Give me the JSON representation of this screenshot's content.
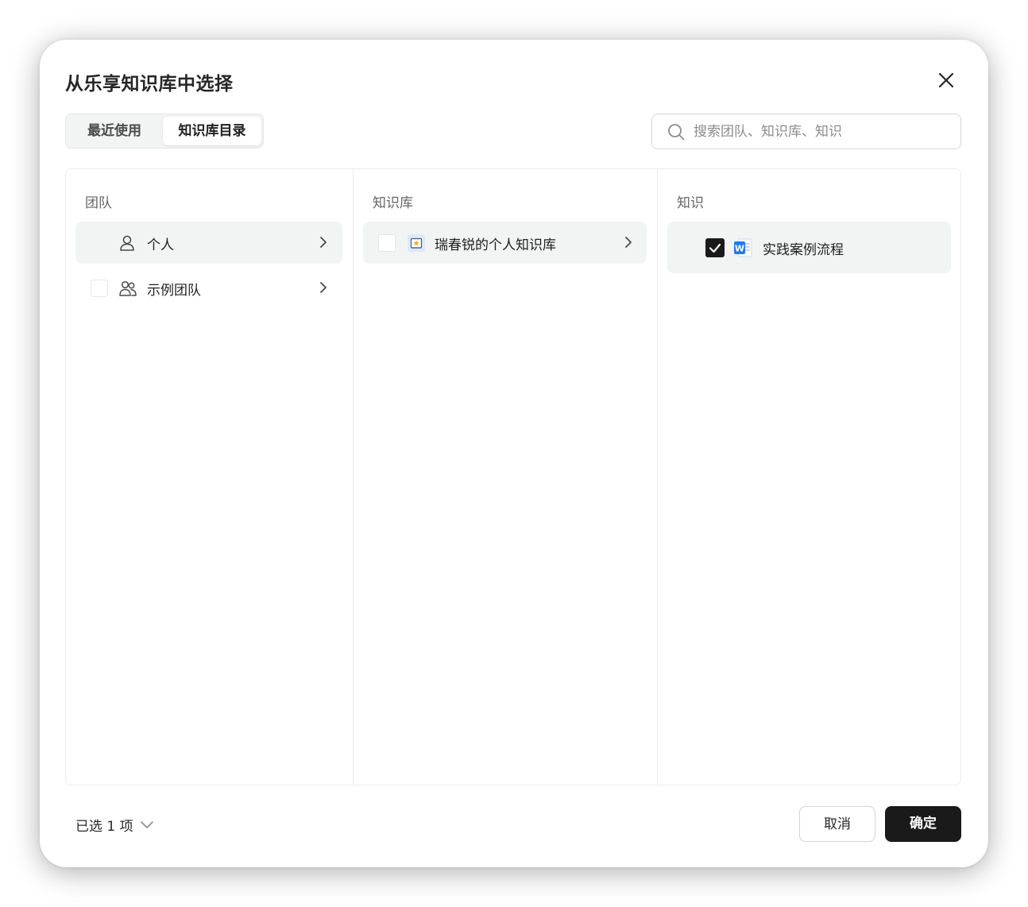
{
  "dialog": {
    "title": "从乐享知识库中选择"
  },
  "tabs": [
    {
      "label": "最近使用",
      "active": false
    },
    {
      "label": "知识库目录",
      "active": true
    }
  ],
  "search": {
    "placeholder": "搜索团队、知识库、知识",
    "value": ""
  },
  "panes": {
    "teams": {
      "header": "团队",
      "items": [
        {
          "label": "个人",
          "icon": "user-icon",
          "selected": true,
          "has_checkbox": false
        },
        {
          "label": "示例团队",
          "icon": "team-icon",
          "selected": false,
          "has_checkbox": true,
          "checked": false
        }
      ]
    },
    "kbs": {
      "header": "知识库",
      "items": [
        {
          "label": "瑞春锐的个人知识库",
          "icon": "knowledge-base-icon",
          "selected": true,
          "checked": false
        }
      ]
    },
    "docs": {
      "header": "知识",
      "items": [
        {
          "label": "实践案例流程",
          "icon": "word-doc-icon",
          "icon_letter": "W",
          "selected": true,
          "checked": true
        }
      ]
    }
  },
  "footer": {
    "selected_count": "已选 1 项",
    "cancel_label": "取消",
    "confirm_label": "确定"
  },
  "colors": {
    "primary_button": "#1a1a1a",
    "selected_row": "#f2f3f3",
    "word_blue": "#1e7cf2"
  }
}
